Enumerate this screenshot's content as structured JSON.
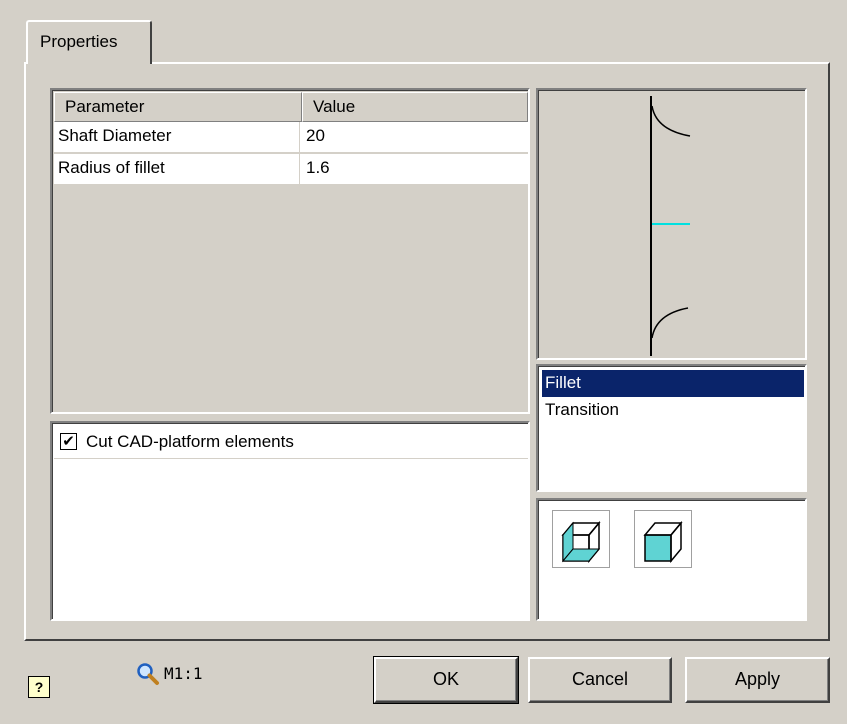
{
  "tabs": [
    {
      "label": "Properties"
    }
  ],
  "grid": {
    "columns": [
      "Parameter",
      "Value"
    ],
    "rows": [
      {
        "name": "Shaft Diameter",
        "value": "20"
      },
      {
        "name": "Radius of fillet",
        "value": "1.6"
      }
    ]
  },
  "options": [
    {
      "label": "Cut CAD-platform elements",
      "checked": true
    }
  ],
  "type_list": {
    "items": [
      "Fillet",
      "Transition"
    ],
    "selected": "Fillet"
  },
  "display_modes": [
    {
      "icon": "wireframe-cube-icon"
    },
    {
      "icon": "shaded-cube-icon"
    }
  ],
  "footer": {
    "help_icon": "help-icon",
    "zoom_icon": "magnifier-icon",
    "scale": "M1:1"
  },
  "buttons": {
    "ok": "OK",
    "cancel": "Cancel",
    "apply": "Apply"
  },
  "colors": {
    "selection": "#0a246a",
    "accent_cyan": "#00e0e0",
    "face": "#d4d0c8"
  }
}
